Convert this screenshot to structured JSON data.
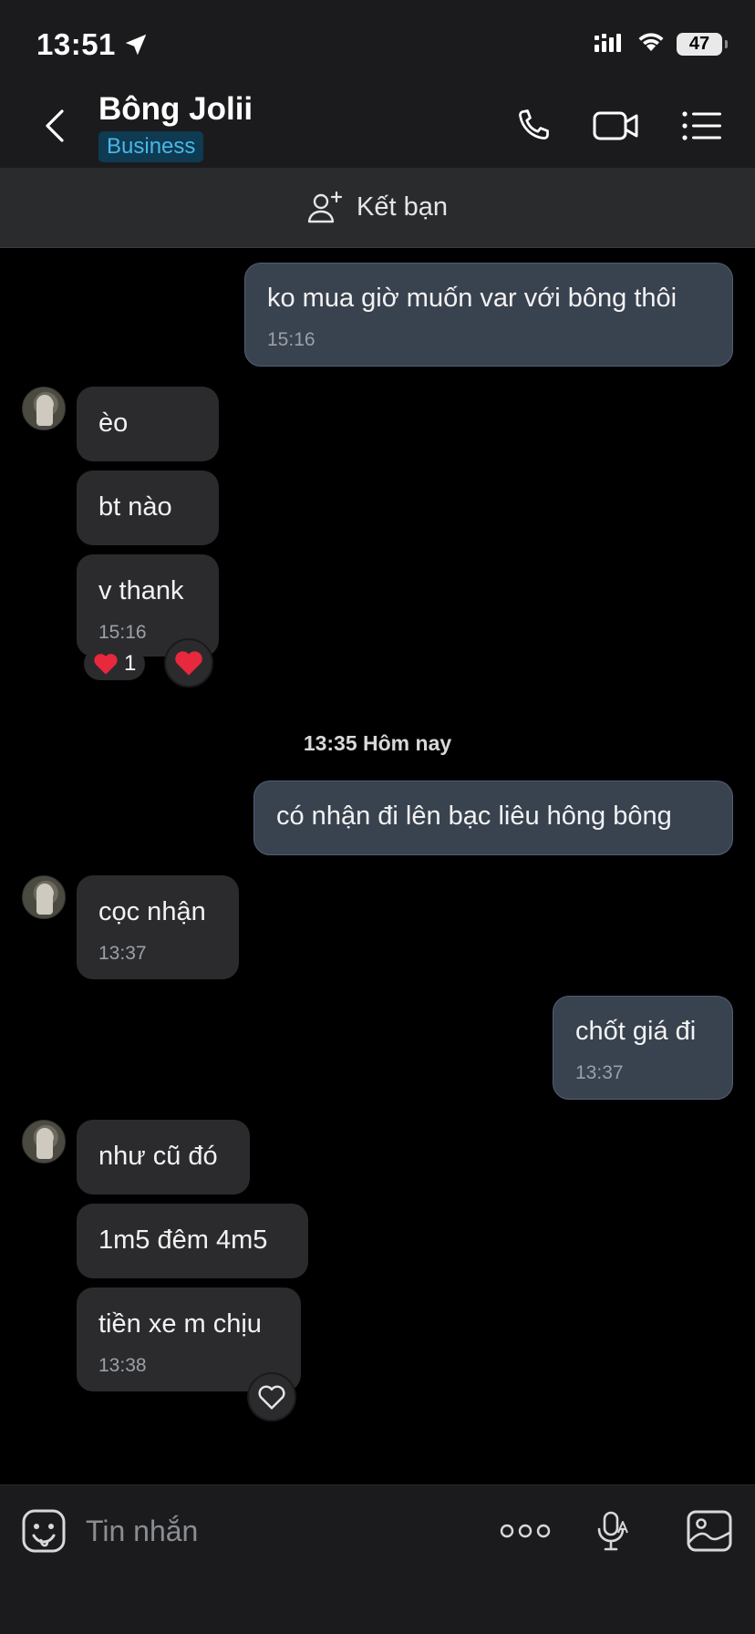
{
  "status": {
    "time": "13:51",
    "battery": "47"
  },
  "header": {
    "name": "Bông Jolii",
    "badge": "Business"
  },
  "add_friend": {
    "label": "Kết bạn"
  },
  "messages": {
    "m1": {
      "text": "ko mua giờ muốn var với bông thôi",
      "time": "15:16"
    },
    "m2": {
      "text": "èo"
    },
    "m3": {
      "text": "bt nào"
    },
    "m4": {
      "text": "v thank",
      "time": "15:16",
      "reaction_count": "1"
    },
    "sep": "13:35 Hôm nay",
    "m5": {
      "text": "có nhận đi lên bạc liêu hông bông"
    },
    "m6": {
      "text": "cọc nhận",
      "time": "13:37"
    },
    "m7": {
      "text": "chốt giá đi",
      "time": "13:37"
    },
    "m8": {
      "text": "như cũ đó"
    },
    "m9": {
      "text": "1m5 đêm 4m5"
    },
    "m10": {
      "text": "tiền xe m chịu",
      "time": "13:38"
    }
  },
  "input": {
    "placeholder": "Tin nhắn"
  },
  "colors": {
    "outgoing_bubble": "#39424f",
    "incoming_bubble": "#2b2b2d",
    "badge_text": "#49b7e8",
    "heart": "#e8283c"
  }
}
